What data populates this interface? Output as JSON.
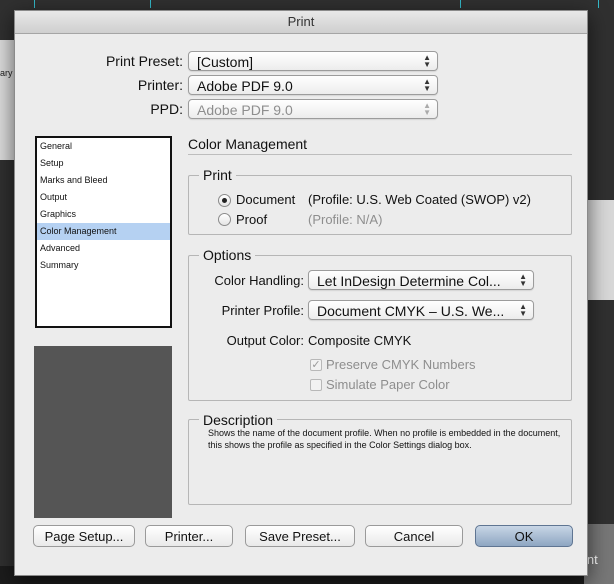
{
  "window": {
    "title": "Print"
  },
  "header": {
    "print_preset_label": "Print Preset:",
    "print_preset_value": "[Custom]",
    "printer_label": "Printer:",
    "printer_value": "Adobe PDF 9.0",
    "ppd_label": "PPD:",
    "ppd_value": "Adobe PDF 9.0"
  },
  "sidebar": {
    "items": [
      {
        "label": "General"
      },
      {
        "label": "Setup"
      },
      {
        "label": "Marks and Bleed"
      },
      {
        "label": "Output"
      },
      {
        "label": "Graphics"
      },
      {
        "label": "Color Management"
      },
      {
        "label": "Advanced"
      },
      {
        "label": "Summary"
      }
    ],
    "selected": "Color Management"
  },
  "main": {
    "section_title": "Color Management",
    "print_group": {
      "title": "Print",
      "document_label": "Document",
      "document_profile": "(Profile: U.S. Web Coated (SWOP) v2)",
      "proof_label": "Proof",
      "proof_profile": "(Profile: N/A)"
    },
    "options_group": {
      "title": "Options",
      "color_handling_label": "Color Handling:",
      "color_handling_value": "Let InDesign Determine Col...",
      "printer_profile_label": "Printer Profile:",
      "printer_profile_value": "Document CMYK – U.S. We...",
      "output_color_label": "Output Color:",
      "output_color_value": "Composite CMYK",
      "preserve_cmyk_label": "Preserve CMYK Numbers",
      "simulate_paper_label": "Simulate Paper Color"
    },
    "description_group": {
      "title": "Description",
      "text": "Shows the name of the document profile. When no profile is embedded in the document, this shows the profile as specified in the Color Settings dialog box."
    }
  },
  "buttons": {
    "page_setup": "Page Setup...",
    "printer": "Printer...",
    "save_preset": "Save Preset...",
    "cancel": "Cancel",
    "ok": "OK"
  },
  "background": {
    "left_fragment": "ary",
    "right_fragment": "int"
  },
  "colors": {
    "selection": "#b5d1f2",
    "dialog_bg": "#ececec",
    "ok_button": "#8ea6c2"
  }
}
